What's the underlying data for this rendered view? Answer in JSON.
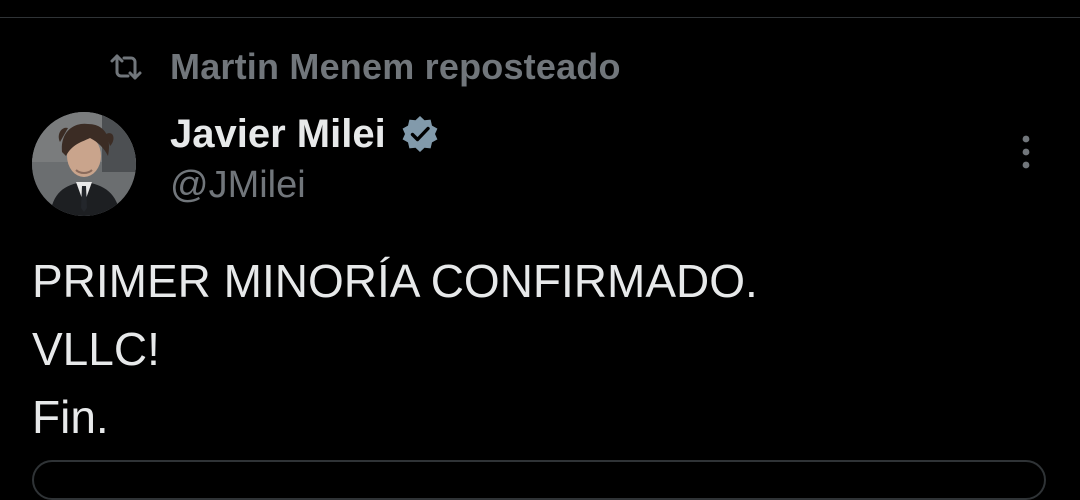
{
  "repost": {
    "icon": "repost-icon",
    "text": "Martin Menem reposteado"
  },
  "author": {
    "name": "Javier Milei",
    "handle": "@JMilei",
    "verified_icon": "verified-badge-icon",
    "avatar_icon": "avatar"
  },
  "menu": {
    "icon": "more-options-icon"
  },
  "tweet": {
    "lines": [
      "PRIMER MINORÍA CONFIRMADO.",
      "VLLC!",
      "Fin."
    ]
  },
  "colors": {
    "background": "#000000",
    "primary_text": "#e7e9ea",
    "secondary_text": "#71767b",
    "verified": "#829aab",
    "divider": "#2f3336"
  }
}
